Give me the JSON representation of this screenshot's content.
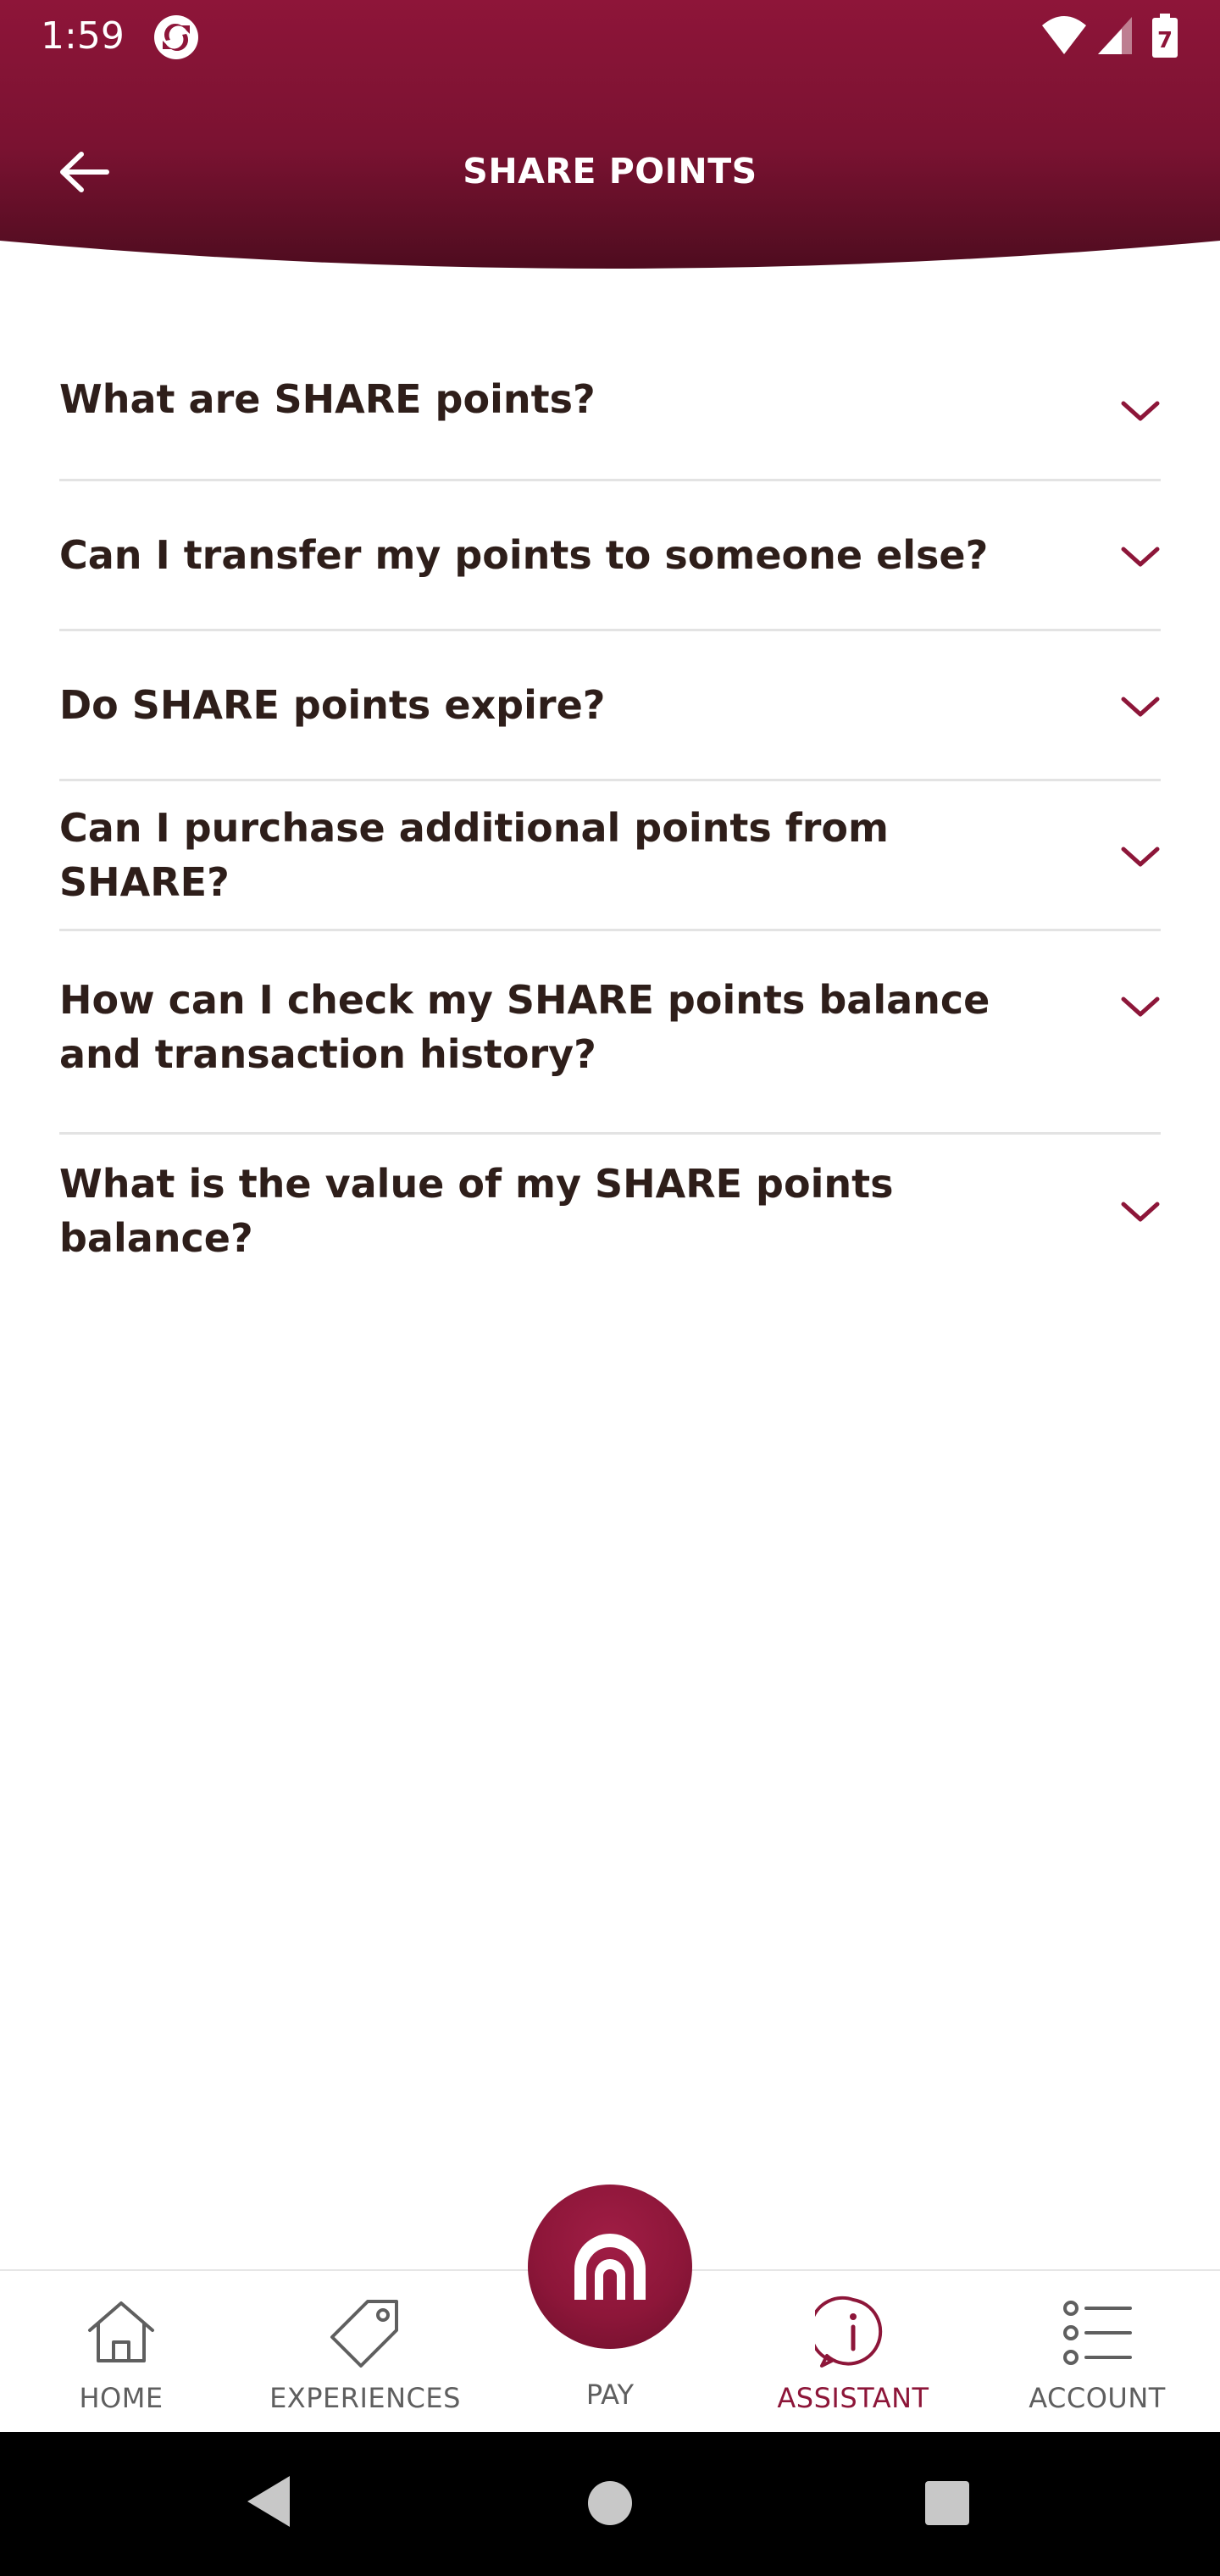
{
  "status_bar": {
    "time": "1:59",
    "battery_level": "7"
  },
  "header": {
    "title": "SHARE POINTS",
    "gradient_top": "#8e1539",
    "gradient_bottom": "#4e0c1f"
  },
  "faq": [
    {
      "question": "What are SHARE points?"
    },
    {
      "question": "Can I transfer my points to someone else?"
    },
    {
      "question": "Do SHARE points expire?"
    },
    {
      "question": "Can I purchase additional points from SHARE?"
    },
    {
      "question": "How can I check my SHARE points balance and transaction history?"
    },
    {
      "question": "What is the value of my SHARE points balance?"
    }
  ],
  "bottom_nav": {
    "items": [
      {
        "label": "HOME",
        "icon": "home-icon"
      },
      {
        "label": "EXPERIENCES",
        "icon": "tag-icon"
      },
      {
        "label": "PAY",
        "icon": "share-logo-icon"
      },
      {
        "label": "ASSISTANT",
        "icon": "info-icon",
        "active": true
      },
      {
        "label": "ACCOUNT",
        "icon": "list-icon"
      }
    ]
  },
  "colors": {
    "accent": "#8d1639",
    "text": "#2e1e1a",
    "divider": "#e3e3e3",
    "inactive_nav": "#5f5f5f"
  }
}
